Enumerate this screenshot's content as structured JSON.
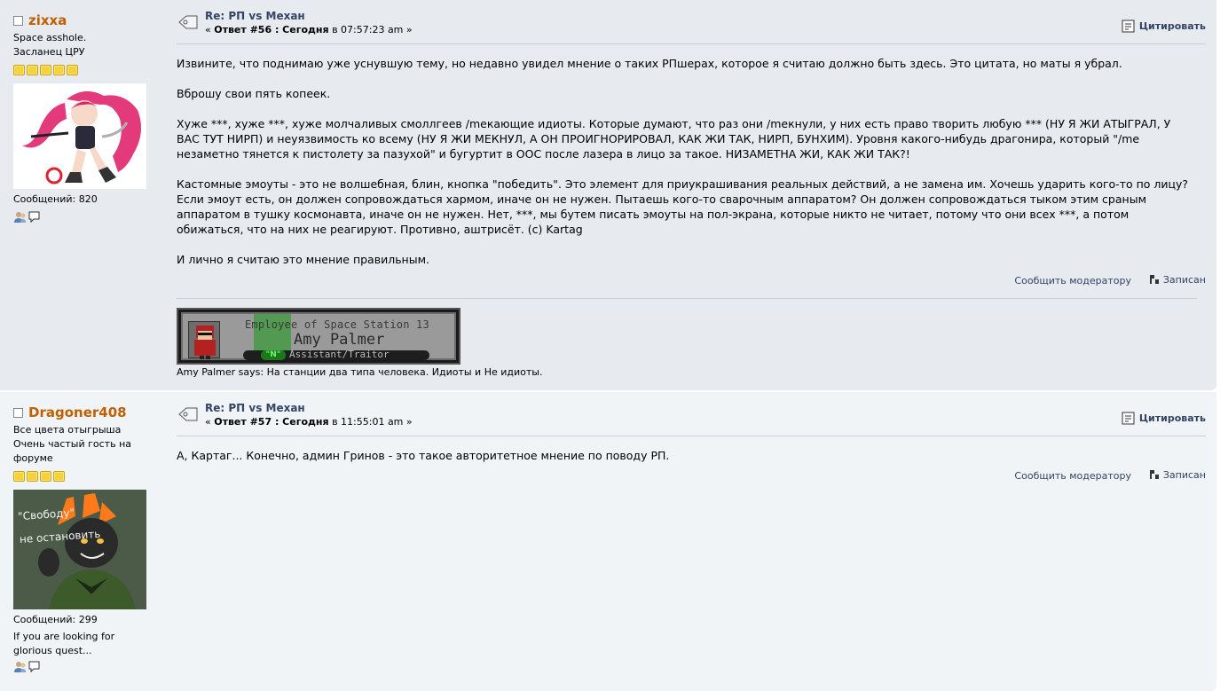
{
  "posts": [
    {
      "author": "zixxa",
      "personal_text": [
        "Space asshole.",
        "Засланец ЦРУ"
      ],
      "stars": 5,
      "post_count": "Сообщений: 820",
      "signature_lines": [],
      "subject": "Re: РП vs Механ",
      "reply_prefix": "«",
      "reply_label": "Ответ #56 : Сегодня",
      "reply_time": "в 07:57:23 am »",
      "quote_label": "Цитировать",
      "paragraphs": [
        "Извините, что поднимаю уже уснувшую тему,  но недавно увидел мнение о таких РПшерах, которое я считаю должно быть здесь. Это цитата, но маты я убрал.",
        "Вброшу свои пять копеек.",
        "Хуже ***, хуже ***, хуже молчаливых смоллгеев /mекающие идиоты. Которые думают, что раз они /mекнули, у них есть право творить любую *** (НУ Я ЖИ АТЫГРАЛ, У ВАС ТУТ НИРП) и неуязвимость ко всему (НУ Я ЖИ МЕКНУЛ, А ОН ПРОИГНОРИРОВАЛ, КАК ЖИ ТАК, НИРП, БУНХИМ). Уровня какого-нибудь драгонира, который \"/me незаметно тянется к пистолету за пазухой\" и бугуртит в ООС после лазера в лицо за такое. НИЗАМЕТНА ЖИ, КАК ЖИ ТАК?!",
        "Кастомные эмоуты - это не волшебная, блин, кнопка \"победить\". Это элемент для приукрашивания реальных действий, а не замена им. Хочешь ударить кого-то по лицу? Если эмоут есть, он должен сопровождаться хармом, иначе он не нужен. Пытаешь кого-то сварочным аппаратом? Он должен сопровождаться тыком этим сраным аппаратом в тушку космонавта, иначе он не нужен. Нет, ***, мы бутем писать эмоуты на пол-экрана, которые никто не читает, потому что они всех ***, а потом обижаться, что на них не реагируют. Противно, аштрисёт. (с) Kartag",
        "И лично я считаю это мнение правильным."
      ],
      "report_label": "Сообщить модератору",
      "logged_label": "Записан",
      "badge": {
        "line1": "Employee of Space Station 13",
        "line2": "Amy Palmer",
        "line3": "Assistant/Traitor",
        "tag": "\"N\""
      },
      "signature": "Amy Palmer says: На станции два типа человека. Идиоты и Не идиоты."
    },
    {
      "author": "Dragoner408",
      "personal_text": [
        "Все цвета отыгрыша",
        "Очень частый гость на форуме"
      ],
      "stars": 4,
      "post_count": "Сообщений: 299",
      "signature_lines": [
        "If you are looking for glorious quest..."
      ],
      "subject": "Re: РП vs Механ",
      "reply_prefix": "«",
      "reply_label": "Ответ #57 : Сегодня",
      "reply_time": "в 11:55:01 am »",
      "quote_label": "Цитировать",
      "paragraphs": [
        "А, Картаг... Конечно, админ Гринов - это такое авторитетное мнение по поводу РП."
      ],
      "report_label": "Сообщить модератору",
      "logged_label": "Записан",
      "avatar_text": [
        "\"Свободу\"",
        "не остановить"
      ]
    }
  ],
  "colors": {
    "author": "#c06002",
    "link": "#334466",
    "post1_bg": "#e7eaef",
    "post2_bg": "#f0f4f7",
    "star": "#f5d236"
  },
  "icons": [
    "subject-icon",
    "quote-icon",
    "logged-icon",
    "profile-icon",
    "pm-icon"
  ]
}
